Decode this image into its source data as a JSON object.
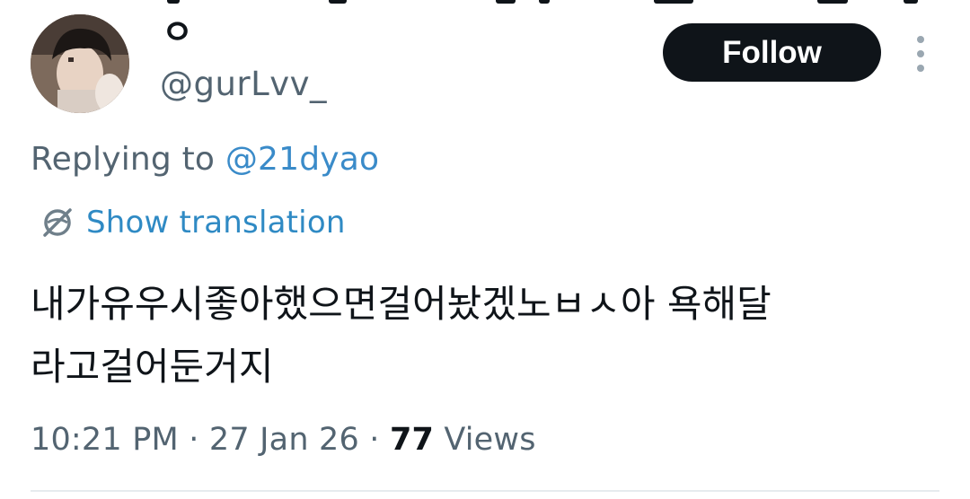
{
  "author": {
    "display_name": "ㅇ",
    "handle": "@gurLvv_"
  },
  "follow_button": {
    "label": "Follow"
  },
  "reply": {
    "prefix": "Replying to ",
    "mention": "@21dyao"
  },
  "translation": {
    "label": "Show translation",
    "icon": "globe-icon"
  },
  "tweet": {
    "lines": [
      "내가유우시좋아했으면걸어놨겠노ㅂㅅ아 욕해달",
      "라고걸어둔거지"
    ]
  },
  "meta": {
    "time": "10:21 PM",
    "separator": " · ",
    "date": "27 Jan 26",
    "views_count": "77",
    "views_label": " Views"
  },
  "colors": {
    "text_primary": "#0f1419",
    "text_secondary": "#536471",
    "accent": "#1d9bf0",
    "follow_bg": "#0f1419"
  }
}
